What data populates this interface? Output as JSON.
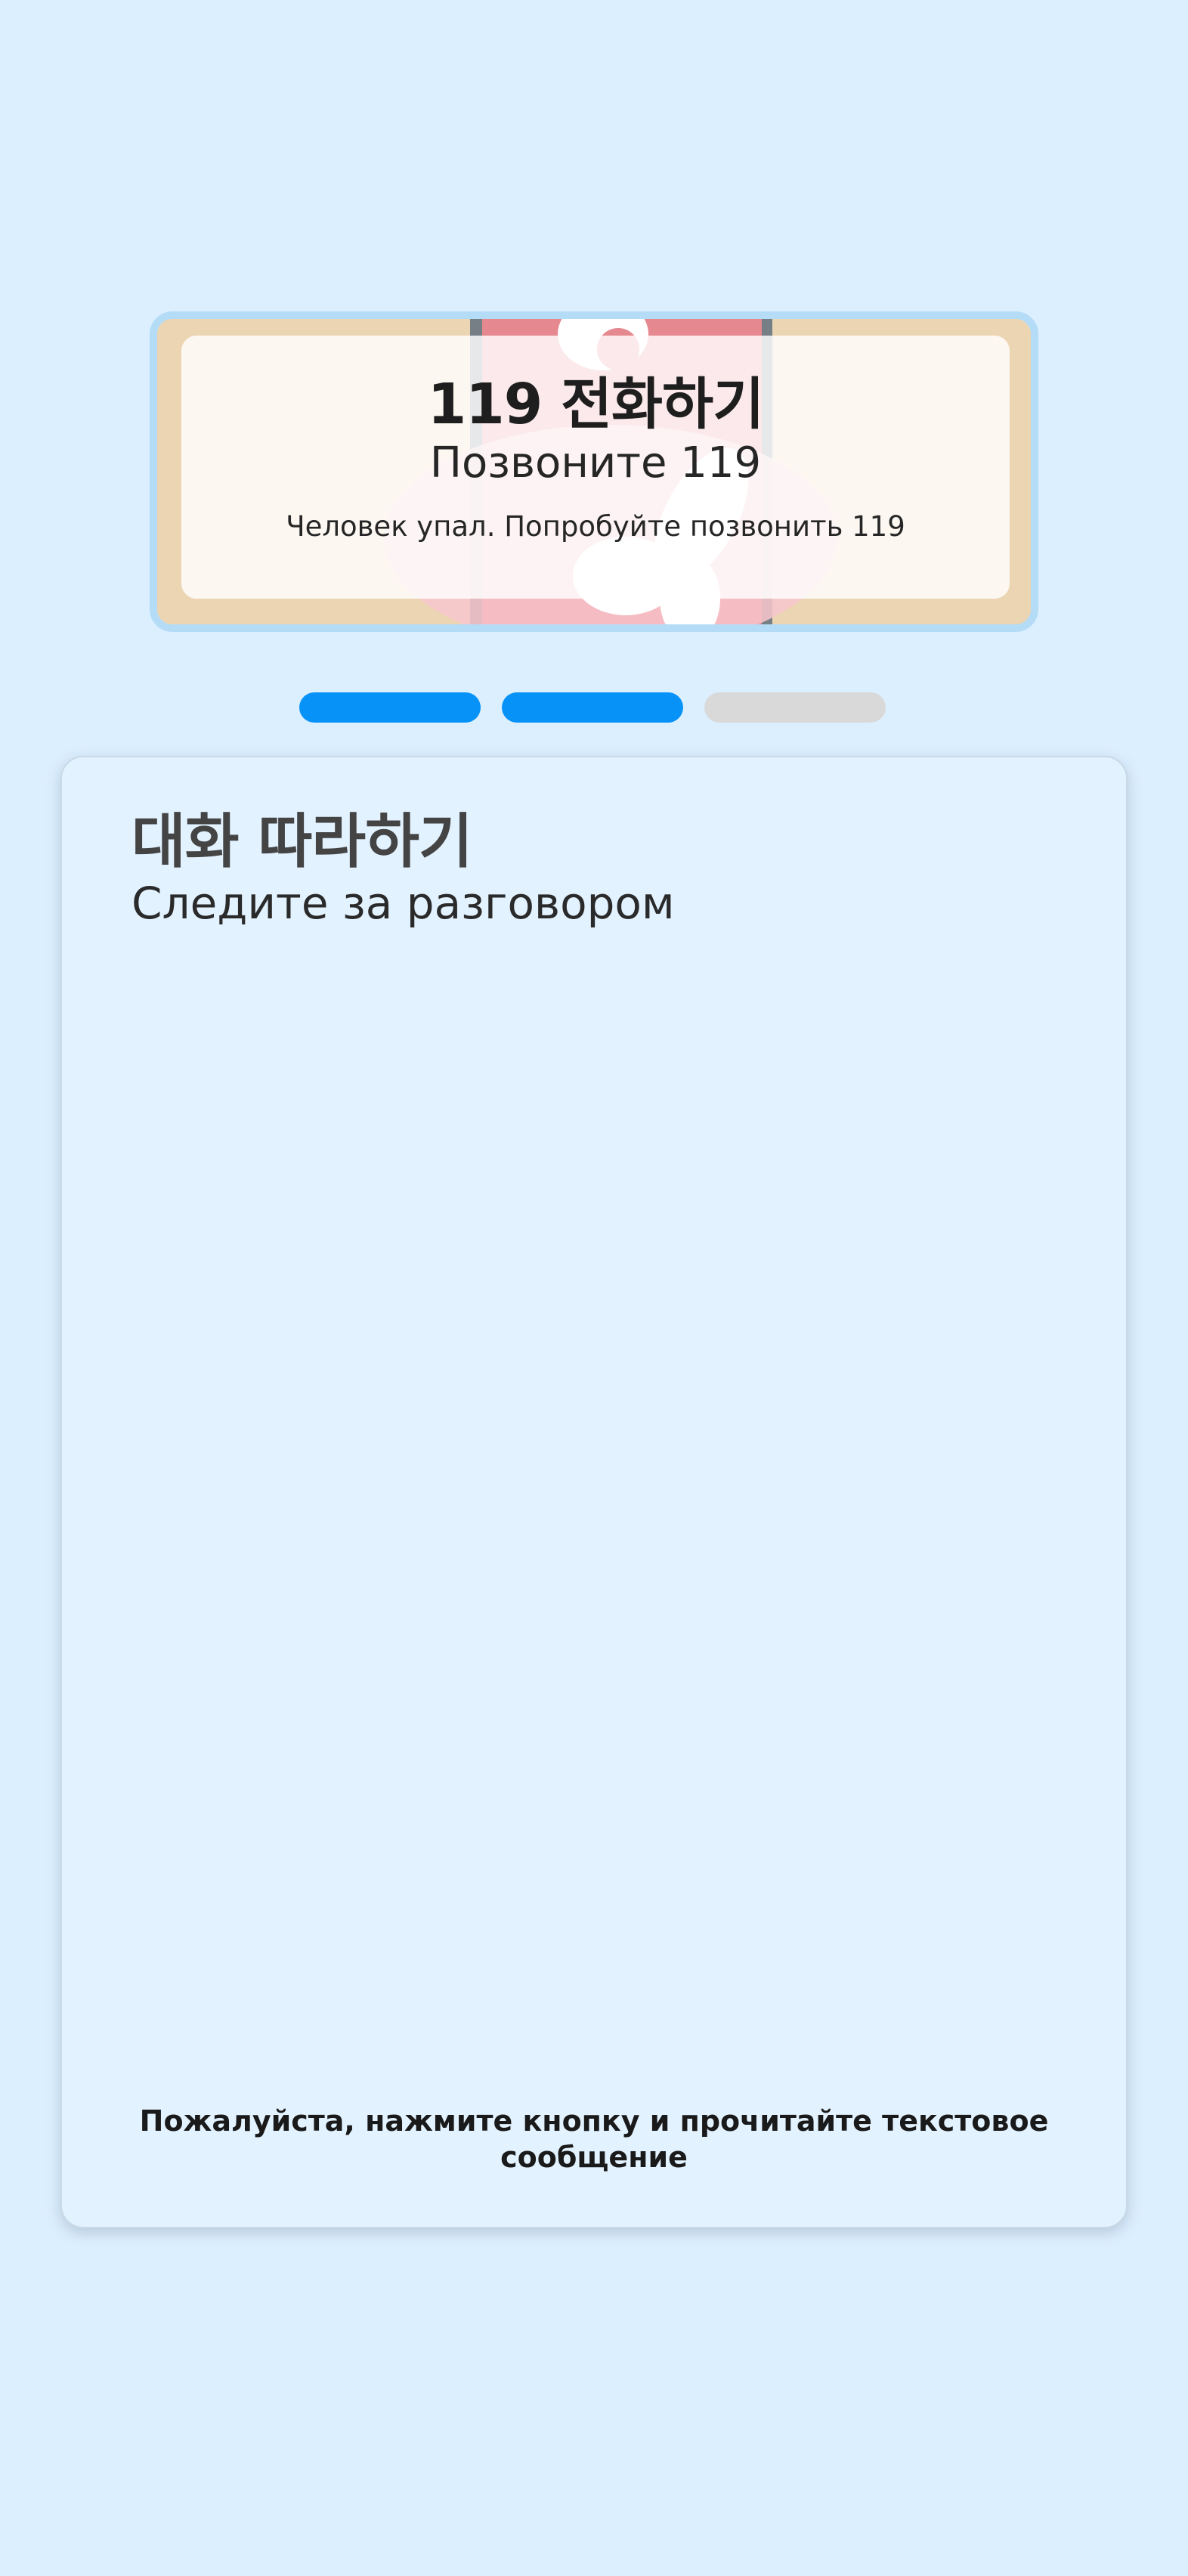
{
  "hero": {
    "title": "119 전화하기",
    "subtitle": "Позвоните 119",
    "description": "Человек упал. Попробуйте позвонить 119",
    "illustration": "phone-call-illustration"
  },
  "steps": {
    "total": 3,
    "completed": 2,
    "active_color": "#0792f8",
    "inactive_color": "#d9d9d9"
  },
  "conversation": {
    "title": "대화 따라하기",
    "subtitle": "Следите за разговором",
    "instruction": "Пожалуйста, нажмите кнопку и прочитайте текстовое сообщение"
  },
  "colors": {
    "background": "#dcefff",
    "panel": "#e2f2ff",
    "hero_border": "#b5dcf7"
  }
}
